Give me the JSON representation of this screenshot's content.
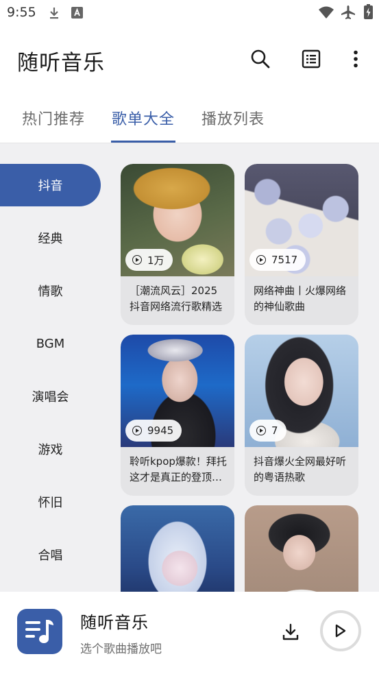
{
  "status_bar": {
    "time": "9:55",
    "icons": [
      "download-icon",
      "a-notification-icon",
      "wifi-icon",
      "airplane-icon",
      "battery-charging-icon"
    ]
  },
  "app_bar": {
    "title": "随听音乐",
    "icons": [
      "search-icon",
      "list-icon",
      "more-vert-icon"
    ]
  },
  "tabs": [
    {
      "label": "热门推荐",
      "active": false
    },
    {
      "label": "歌单大全",
      "active": true
    },
    {
      "label": "播放列表",
      "active": false
    }
  ],
  "categories": [
    {
      "label": "抖音",
      "active": true
    },
    {
      "label": "经典",
      "active": false
    },
    {
      "label": "情歌",
      "active": false
    },
    {
      "label": "BGM",
      "active": false
    },
    {
      "label": "演唱会",
      "active": false
    },
    {
      "label": "游戏",
      "active": false
    },
    {
      "label": "怀旧",
      "active": false
    },
    {
      "label": "合唱",
      "active": false
    }
  ],
  "playlists": [
    {
      "title": "［潮流风云］2025抖音网络流行歌精选",
      "plays": "1万"
    },
    {
      "title": "网络神曲丨火爆网络的神仙歌曲",
      "plays": "7517"
    },
    {
      "title": "聆听kpop爆款！拜托这才是真正的登顶歌曲",
      "plays": "9945"
    },
    {
      "title": "抖音爆火全网最好听的粤语热歌",
      "plays": "7"
    },
    {
      "title": "",
      "plays": ""
    },
    {
      "title": "",
      "plays": ""
    }
  ],
  "player": {
    "title": "随听音乐",
    "subtitle": "选个歌曲播放吧"
  },
  "colors": {
    "accent": "#3a5ea8",
    "background": "#f0f0f2",
    "card": "#e4e4e6"
  }
}
